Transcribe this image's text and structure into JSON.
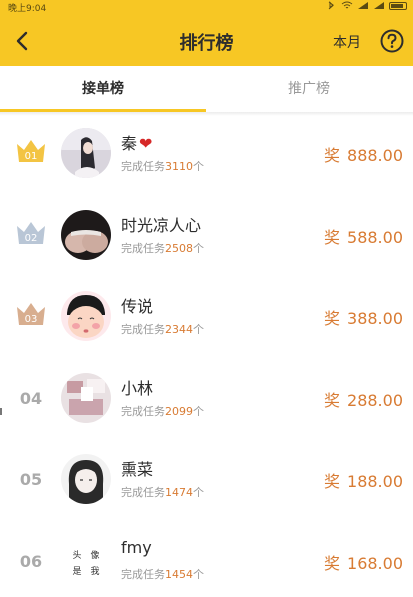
{
  "status_bar": {
    "time": "晚上9:04"
  },
  "header": {
    "title": "排行榜",
    "period": "本月"
  },
  "tabs": [
    {
      "label": "接单榜",
      "active": true
    },
    {
      "label": "推广榜",
      "active": false
    }
  ],
  "rows": [
    {
      "rank": "01",
      "badge": "gold",
      "name": "秦",
      "heart": "❤",
      "task_prefix": "完成任务",
      "task_count": "3110",
      "task_unit": "个",
      "reward_label": "奖",
      "reward_value": "888.00"
    },
    {
      "rank": "02",
      "badge": "silver",
      "name": " 时光凉人心",
      "heart": "",
      "task_prefix": "完成任务",
      "task_count": "2508",
      "task_unit": "个",
      "reward_label": "奖",
      "reward_value": "588.00"
    },
    {
      "rank": "03",
      "badge": "bronze",
      "name": "传说",
      "heart": "",
      "task_prefix": "完成任务",
      "task_count": "2344",
      "task_unit": "个",
      "reward_label": "奖",
      "reward_value": "388.00"
    },
    {
      "rank": "04",
      "badge": "",
      "name": "小林",
      "heart": "",
      "task_prefix": "完成任务",
      "task_count": "2099",
      "task_unit": "个",
      "reward_label": "奖",
      "reward_value": "288.00"
    },
    {
      "rank": "05",
      "badge": "",
      "name": "熏菜",
      "heart": "",
      "task_prefix": "完成任务",
      "task_count": "1474",
      "task_unit": "个",
      "reward_label": "奖",
      "reward_value": "188.00"
    },
    {
      "rank": "06",
      "badge": "",
      "name": "fmy",
      "heart": "",
      "task_prefix": "完成任务",
      "task_count": "1454",
      "task_unit": "个",
      "reward_label": "奖",
      "reward_value": "168.00"
    }
  ],
  "avatar_placeholder_text": [
    "头",
    "像",
    "是",
    "我"
  ],
  "colors": {
    "accent": "#f7c724",
    "reward": "#d87b33",
    "gold": "#f3c443",
    "silver": "#b9c6d6",
    "bronze": "#d8ae8f"
  }
}
